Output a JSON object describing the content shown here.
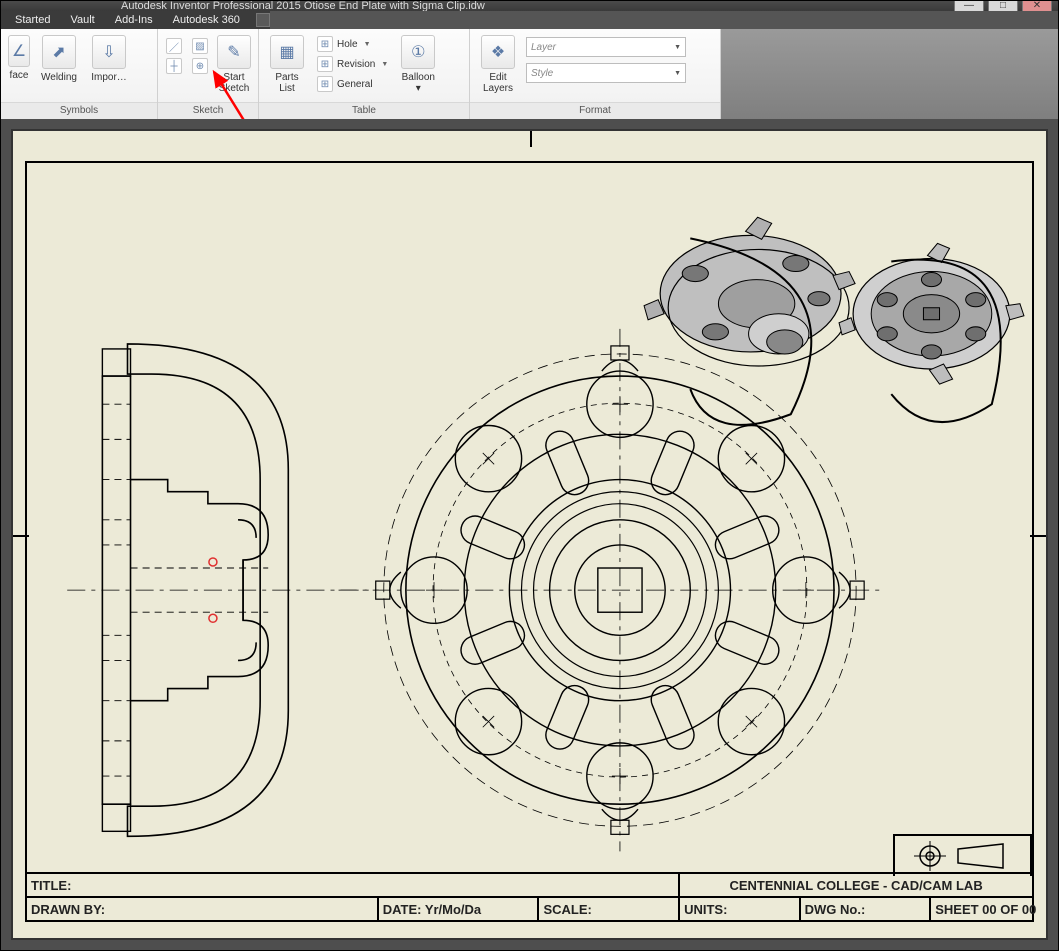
{
  "window": {
    "title": "Autodesk Inventor Professional 2015   Otiose End Plate with Sigma Clip.idw",
    "controls": {
      "min": "—",
      "max": "□",
      "close": "✕"
    }
  },
  "menu": {
    "started": "Started",
    "vault": "Vault",
    "addins": "Add-Ins",
    "a360": "Autodesk 360"
  },
  "ribbon": {
    "symbols": {
      "label": "Symbols",
      "face": "face",
      "welding": "Welding",
      "import": "Impor…"
    },
    "sketch": {
      "label": "Sketch",
      "start": "Start\nSketch"
    },
    "table": {
      "label": "Table",
      "parts": "Parts\nList",
      "hole": "Hole",
      "revision": "Revision",
      "general": "General",
      "balloon": "Balloon"
    },
    "format": {
      "label": "Format",
      "edit": "Edit\nLayers",
      "layer": "Layer",
      "style": "Style"
    }
  },
  "titleblock": {
    "title_lbl": "TITLE:",
    "org": "CENTENNIAL COLLEGE - CAD/CAM LAB",
    "drawn_lbl": "DRAWN BY:",
    "date_lbl": "DATE: Yr/Mo/Da",
    "scale_lbl": "SCALE:",
    "units_lbl": "UNITS:",
    "dwg_lbl": "DWG No.:",
    "sheet_lbl": "SHEET 00 OF 00"
  }
}
